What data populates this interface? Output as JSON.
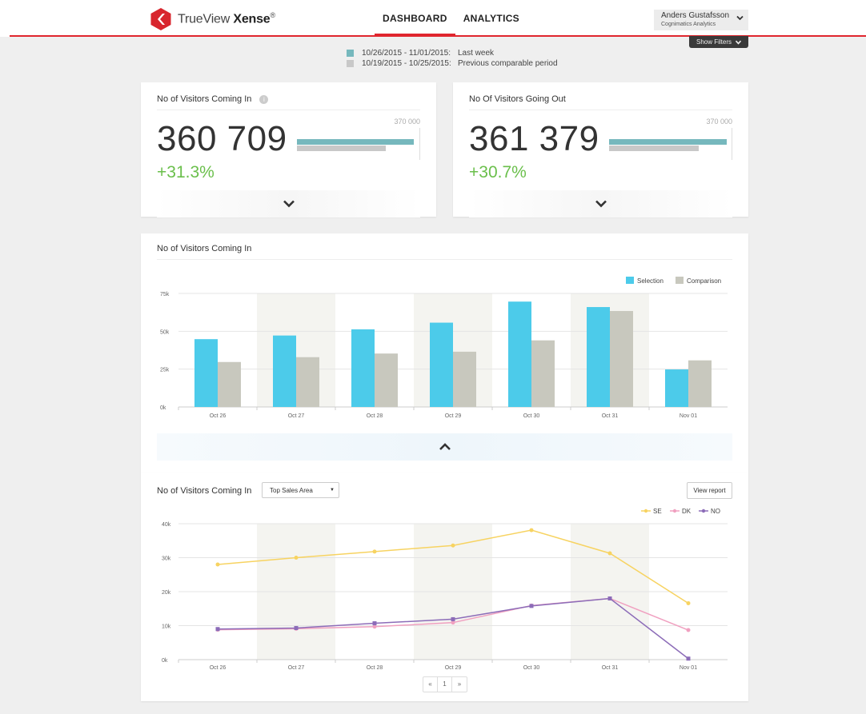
{
  "header": {
    "brand_name": "TrueView",
    "brand_product": "Xense",
    "brand_mark": "®",
    "nav": [
      "DASHBOARD",
      "ANALYTICS"
    ],
    "user_name": "Anders Gustafsson",
    "user_org": "Cognimatics Analytics",
    "show_filters": "Show Filters",
    "accent_color": "#e0262e"
  },
  "period_legend": [
    {
      "dates": "10/26/2015 - 11/01/2015:",
      "label": "Last week",
      "color": "#76b8bd"
    },
    {
      "dates": "10/19/2015 - 10/25/2015:",
      "label": "Previous comparable period",
      "color": "#c8c8c8"
    }
  ],
  "kpis": [
    {
      "title": "No of Visitors Coming In",
      "value": "360 709",
      "change": "+31.3%",
      "max_label": "370 000",
      "selection": 360709,
      "comparison": 274800,
      "max": 370000
    },
    {
      "title": "No Of Visitors Going Out",
      "value": "361 379",
      "change": "+30.7%",
      "max_label": "370 000",
      "selection": 361379,
      "comparison": 276500,
      "max": 370000
    }
  ],
  "bar_section": {
    "title": "No of Visitors Coming In"
  },
  "line_section": {
    "title": "No of Visitors Coming In",
    "dropdown_value": "Top Sales Area",
    "view_report": "View report",
    "pager": [
      "«",
      "1",
      "»"
    ]
  },
  "chart_data": [
    {
      "type": "bar",
      "categories": [
        "Oct 26",
        "Oct 27",
        "Oct 28",
        "Oct 29",
        "Oct 30",
        "Oct 31",
        "Nov 01"
      ],
      "series": [
        {
          "name": "Selection",
          "color": "#4ccbea",
          "values": [
            44800,
            47200,
            51300,
            55700,
            69600,
            66000,
            24800
          ]
        },
        {
          "name": "Comparison",
          "color": "#c8c8be",
          "values": [
            29700,
            32900,
            35300,
            36500,
            44000,
            63400,
            30800
          ]
        }
      ],
      "ylim": [
        0,
        75000
      ],
      "y_ticks": [
        0,
        25000,
        50000,
        75000
      ],
      "y_tick_labels": [
        "0k",
        "25k",
        "50k",
        "75k"
      ],
      "legend_position": "top-right",
      "grid": true
    },
    {
      "type": "line",
      "categories": [
        "Oct 26",
        "Oct 27",
        "Oct 28",
        "Oct 29",
        "Oct 30",
        "Oct 31",
        "Nov 01"
      ],
      "series": [
        {
          "name": "SE",
          "color": "#f7d361",
          "values": [
            28000,
            30000,
            31800,
            33600,
            38100,
            31300,
            16600
          ]
        },
        {
          "name": "DK",
          "color": "#f0a0c0",
          "values": [
            8800,
            9100,
            9700,
            10900,
            15900,
            18000,
            8700
          ]
        },
        {
          "name": "NO",
          "color": "#8c6cb8",
          "values": [
            9000,
            9300,
            10700,
            11900,
            15800,
            18000,
            300
          ]
        }
      ],
      "ylim": [
        0,
        40000
      ],
      "y_ticks": [
        0,
        10000,
        20000,
        30000,
        40000
      ],
      "y_tick_labels": [
        "0k",
        "10k",
        "20k",
        "30k",
        "40k"
      ],
      "legend_position": "top-right",
      "grid": true
    }
  ]
}
